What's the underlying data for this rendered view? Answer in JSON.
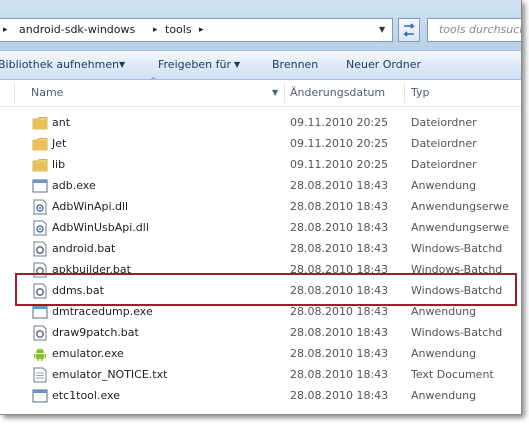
{
  "address": {
    "breadcrumbs": [
      "android-sdk-windows",
      "tools"
    ]
  },
  "search": {
    "placeholder": "tools durchsuchen"
  },
  "toolbar": {
    "library_label": "Bibliothek aufnehmen",
    "share_label": "Freigeben für",
    "burn_label": "Brennen",
    "new_folder_label": "Neuer Ordner"
  },
  "columns": {
    "name": "Name",
    "date": "Änderungsdatum",
    "type": "Typ"
  },
  "files": [
    {
      "name": "ant",
      "date": "09.11.2010 20:25",
      "type": "Dateiordner",
      "icon": "folder-icon"
    },
    {
      "name": "Jet",
      "date": "09.11.2010 20:25",
      "type": "Dateiordner",
      "icon": "folder-icon"
    },
    {
      "name": "lib",
      "date": "09.11.2010 20:25",
      "type": "Dateiordner",
      "icon": "folder-icon"
    },
    {
      "name": "adb.exe",
      "date": "28.08.2010 18:43",
      "type": "Anwendung",
      "icon": "exe-icon"
    },
    {
      "name": "AdbWinApi.dll",
      "date": "28.08.2010 18:43",
      "type": "Anwendungserwe",
      "icon": "dll-icon"
    },
    {
      "name": "AdbWinUsbApi.dll",
      "date": "28.08.2010 18:43",
      "type": "Anwendungserwe",
      "icon": "dll-icon"
    },
    {
      "name": "android.bat",
      "date": "28.08.2010 18:43",
      "type": "Windows-Batchd",
      "icon": "bat-icon"
    },
    {
      "name": "apkbuilder.bat",
      "date": "28.08.2010 18:43",
      "type": "Windows-Batchd",
      "icon": "bat-icon"
    },
    {
      "name": "ddms.bat",
      "date": "28.08.2010 18:43",
      "type": "Windows-Batchd",
      "icon": "bat-icon"
    },
    {
      "name": "dmtracedump.exe",
      "date": "28.08.2010 18:43",
      "type": "Anwendung",
      "icon": "exe-icon"
    },
    {
      "name": "draw9patch.bat",
      "date": "28.08.2010 18:43",
      "type": "Windows-Batchd",
      "icon": "bat-icon"
    },
    {
      "name": "emulator.exe",
      "date": "28.08.2010 18:43",
      "type": "Anwendung",
      "icon": "android-icon"
    },
    {
      "name": "emulator_NOTICE.txt",
      "date": "28.08.2010 18:43",
      "type": "Text Document",
      "icon": "text-file-icon"
    },
    {
      "name": "etc1tool.exe",
      "date": "28.08.2010 18:43",
      "type": "Anwendung",
      "icon": "exe-icon"
    }
  ],
  "highlighted_file": "ddms.bat",
  "colors": {
    "highlight_border": "#9c1f24",
    "toolbar_text": "#1e395b",
    "folder": "#e8c15b"
  }
}
